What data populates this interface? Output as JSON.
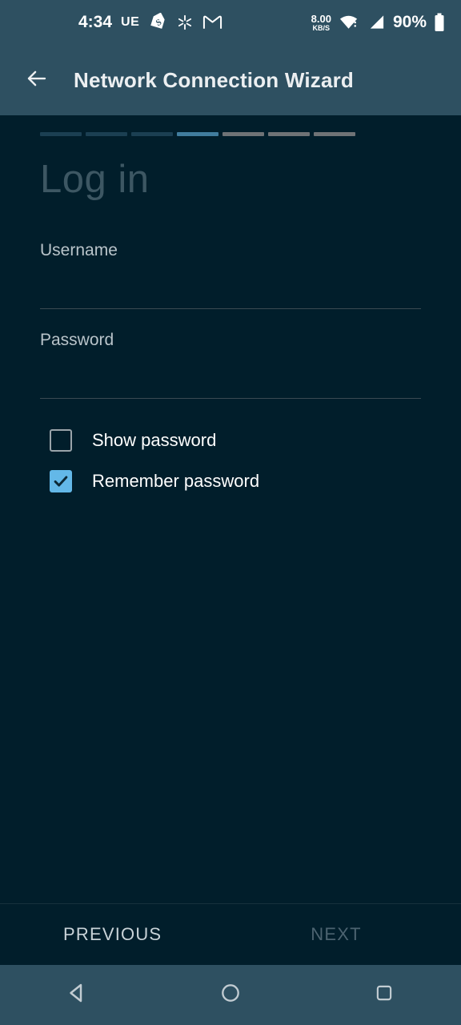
{
  "status_bar": {
    "time": "4:34",
    "carrier": "UE",
    "icons": [
      "price-tag-icon",
      "asterisk-icon",
      "gmail-icon"
    ],
    "network_speed_value": "8.00",
    "network_speed_unit": "KB/S",
    "wifi_icon": "wifi-icon",
    "signal_icon": "cellular-signal-icon",
    "battery_percent": "90%",
    "battery_icon": "battery-full-icon",
    "background_color": "#2e5061"
  },
  "app_bar": {
    "back_icon": "arrow-back-icon",
    "title": "Network Connection Wizard",
    "background_color": "#2e5061",
    "title_color": "#eceff1"
  },
  "wizard": {
    "total_steps": 7,
    "current_step": 4,
    "step_states": [
      "done",
      "done",
      "done",
      "current",
      "todo",
      "todo",
      "todo"
    ],
    "colors": {
      "done": "#1b3f52",
      "current": "#417d9e",
      "todo": "#6f7376"
    }
  },
  "page": {
    "title": "Log in",
    "title_color": "#3d5763",
    "background_color": "#011e2b"
  },
  "form": {
    "fields": [
      {
        "name": "username",
        "label": "Username",
        "value": ""
      },
      {
        "name": "password",
        "label": "Password",
        "value": ""
      }
    ],
    "checkboxes": [
      {
        "name": "show-password",
        "label": "Show password",
        "checked": false
      },
      {
        "name": "remember-password",
        "label": "Remember password",
        "checked": true
      }
    ],
    "checkbox_checked_color": "#63b8e8"
  },
  "footer": {
    "previous_label": "PREVIOUS",
    "next_label": "NEXT",
    "previous_enabled": true,
    "next_enabled": false
  },
  "nav_bar": {
    "back_icon": "nav-back-triangle-icon",
    "home_icon": "nav-home-circle-icon",
    "recents_icon": "nav-recents-square-icon",
    "background_color": "#2e5061"
  }
}
